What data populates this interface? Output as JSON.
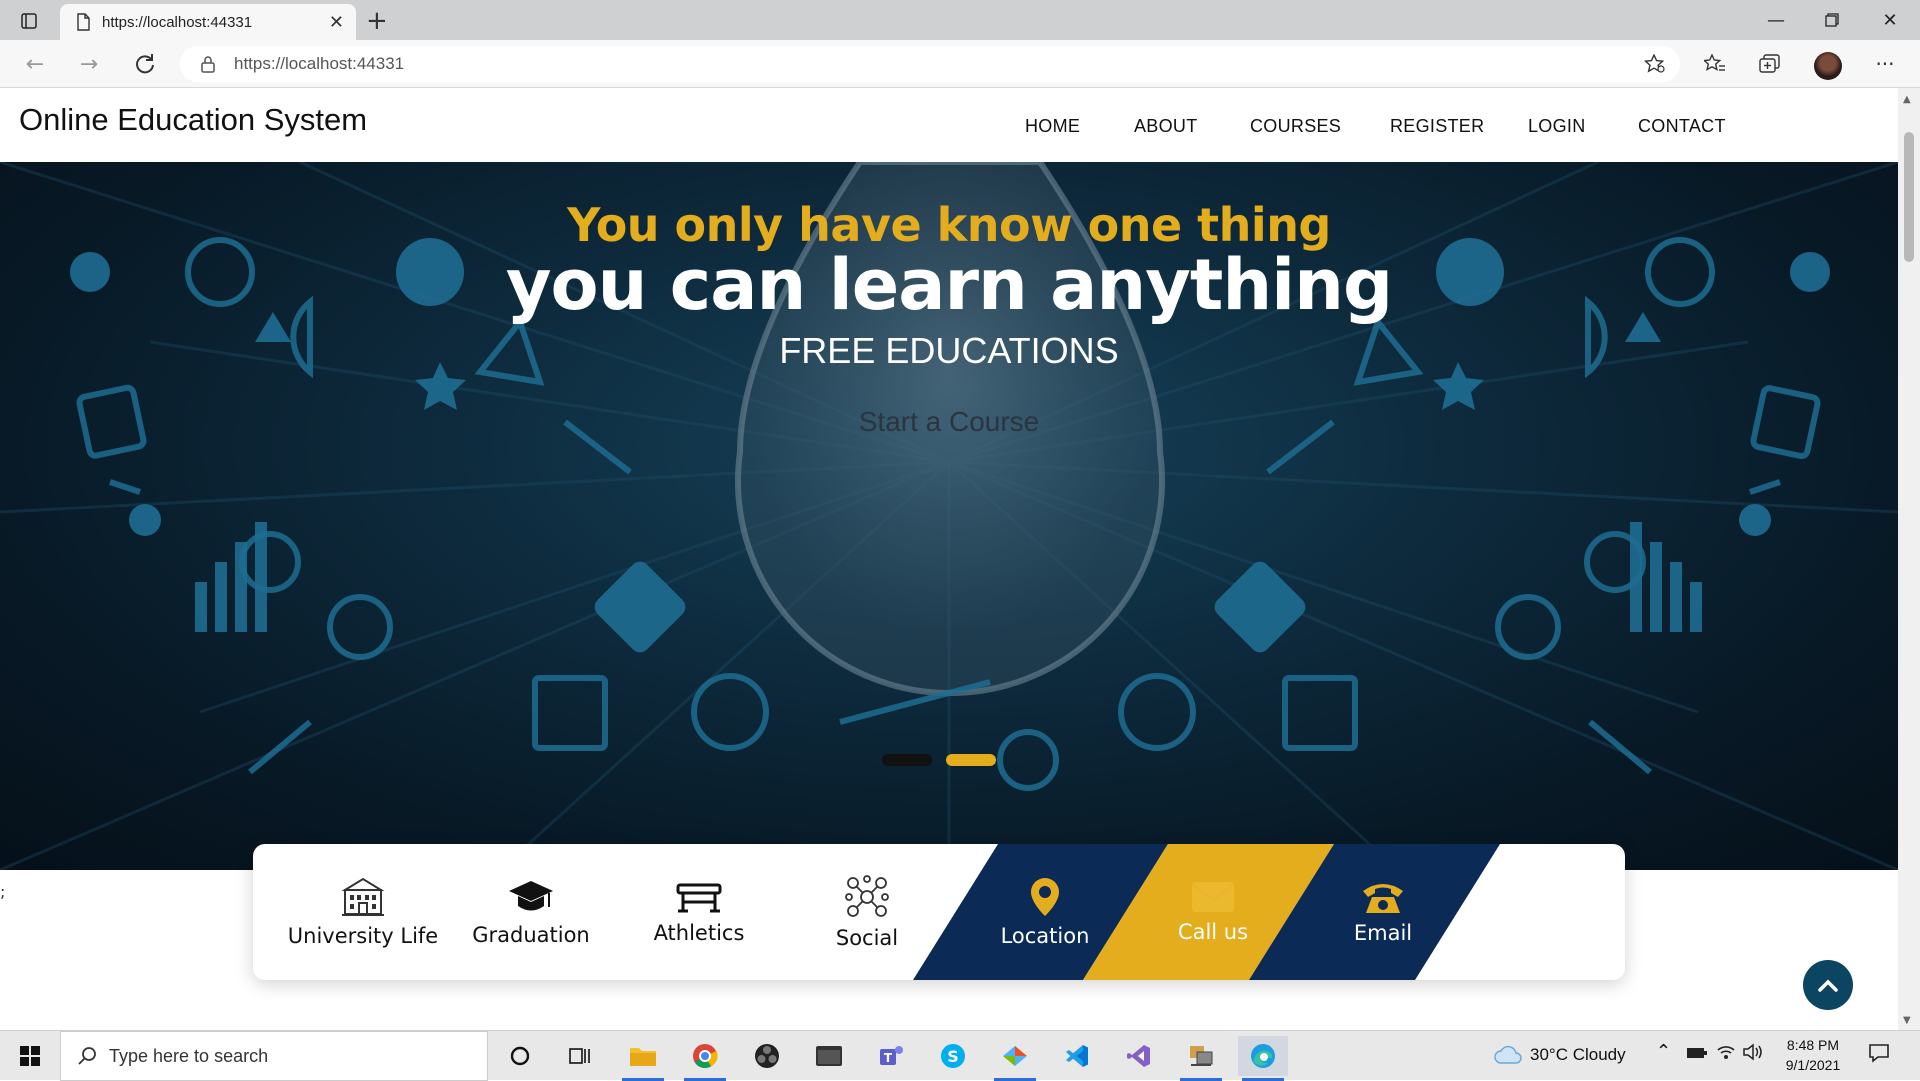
{
  "browser": {
    "tab_title": "https://localhost:44331",
    "url": "https://localhost:44331"
  },
  "site": {
    "brand": "Online Education System",
    "nav": [
      {
        "label": "HOME"
      },
      {
        "label": "ABOUT"
      },
      {
        "label": "COURSES"
      },
      {
        "label": "REGISTER"
      },
      {
        "label": "LOGIN"
      },
      {
        "label": "CONTACT"
      }
    ]
  },
  "hero": {
    "line1": "You only have know one thing",
    "line2": "you can learn anything",
    "line3": "FREE EDUCATIONS",
    "cta": "Start a Course",
    "colors": {
      "accent": "#e3ad1e",
      "dark": "#0e2c3f",
      "navy": "#0b2a55"
    }
  },
  "features": [
    {
      "label": "University Life",
      "icon": "university-building-icon"
    },
    {
      "label": "Graduation",
      "icon": "graduation-cap-icon"
    },
    {
      "label": "Athletics",
      "icon": "gymnastics-bench-icon"
    },
    {
      "label": "Social",
      "icon": "social-network-icon"
    },
    {
      "label": "Location",
      "icon": "map-pin-icon"
    },
    {
      "label": "Call us",
      "icon": "envelope-icon"
    },
    {
      "label": "Email",
      "icon": "telephone-icon"
    }
  ],
  "stray_text": ";",
  "taskbar": {
    "search_placeholder": "Type here to search",
    "weather": "30°C  Cloudy",
    "time": "8:48 PM",
    "date": "9/1/2021"
  }
}
